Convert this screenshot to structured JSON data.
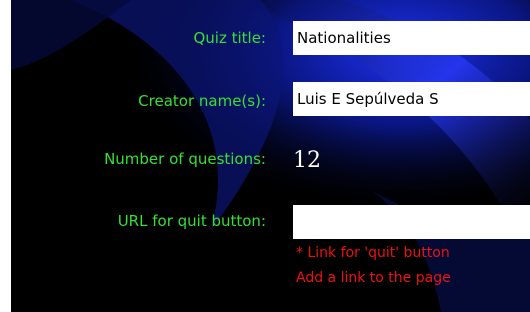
{
  "form": {
    "quiz_title": {
      "label": "Quiz title:",
      "value": "Nationalities"
    },
    "creator_names": {
      "label": "Creator name(s):",
      "value": "Luis E Sepúlveda S"
    },
    "number_of_questions": {
      "label": "Number of questions:",
      "value": "12"
    },
    "quit_url": {
      "label": "URL for quit button:",
      "value": "",
      "note_line1": "* Link for 'quit' button",
      "note_line2": "Add a link to the page"
    }
  },
  "colors": {
    "background": "#000000",
    "label_green": "#33e033",
    "note_red": "#ee1111",
    "swoosh_blue": "#1a2bd6"
  }
}
